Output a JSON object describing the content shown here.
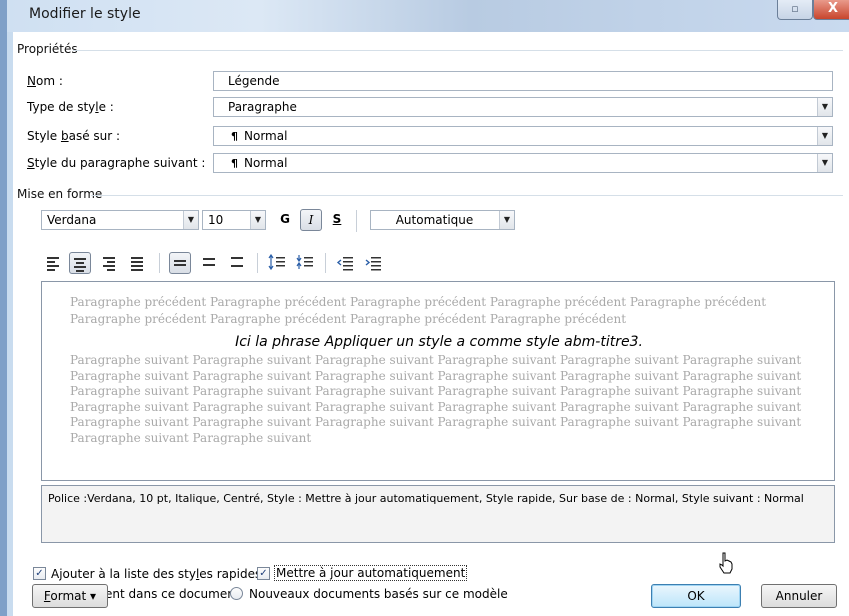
{
  "window": {
    "title": "Modifier le style",
    "restore_glyph": "▫",
    "close_glyph": "X"
  },
  "groups": {
    "properties": "Propriétés",
    "formatting": "Mise en forme"
  },
  "properties": {
    "name_label_u": "N",
    "name_label_rest": "om :",
    "name_value": "Légende",
    "type_label_a": "Type de sty",
    "type_label_u": "l",
    "type_label_b": "e :",
    "type_value": "Paragraphe",
    "based_label_a": "Style ",
    "based_label_u": "b",
    "based_label_b": "asé sur :",
    "based_value": "Normal",
    "next_label_u": "S",
    "next_label_rest": "tyle du paragraphe suivant :",
    "next_value": "Normal",
    "pilcrow": "¶"
  },
  "formatting": {
    "font": "Verdana",
    "size": "10",
    "bold": "G",
    "italic": "I",
    "underline": "S",
    "color": "Automatique"
  },
  "preview": {
    "previous": "Paragraphe précédent Paragraphe précédent Paragraphe précédent Paragraphe précédent Paragraphe précédent Paragraphe précédent Paragraphe précédent Paragraphe précédent Paragraphe précédent",
    "main": "Ici la phrase Appliquer un style a comme style abm-titre3.",
    "following": "Paragraphe suivant Paragraphe suivant Paragraphe suivant Paragraphe suivant Paragraphe suivant Paragraphe suivant Paragraphe suivant Paragraphe suivant Paragraphe suivant Paragraphe suivant Paragraphe suivant Paragraphe suivant Paragraphe suivant Paragraphe suivant Paragraphe suivant Paragraphe suivant Paragraphe suivant Paragraphe suivant Paragraphe suivant Paragraphe suivant Paragraphe suivant Paragraphe suivant Paragraphe suivant Paragraphe suivant Paragraphe suivant Paragraphe suivant Paragraphe suivant Paragraphe suivant Paragraphe suivant Paragraphe suivant Paragraphe suivant Paragraphe suivant"
  },
  "description": "Police :Verdana, 10 pt, Italique, Centré, Style : Mettre à jour automatiquement, Style rapide, Sur base de : Normal, Style suivant : Normal",
  "options": {
    "quick_styles_a": "Ajouter à la liste des sty",
    "quick_styles_u": "l",
    "quick_styles_b": "es rapides",
    "auto_update": "Mettre à jour automatiquement",
    "only_doc": "Uniquement dans ce document",
    "new_docs": "Nouveaux documents basés sur ce modèle",
    "check_glyph": "✓"
  },
  "buttons": {
    "format_u": "F",
    "format_rest": "ormat",
    "format_arrow": "▾",
    "ok": "OK",
    "cancel": "Annuler"
  },
  "arrow_glyph": "▼"
}
